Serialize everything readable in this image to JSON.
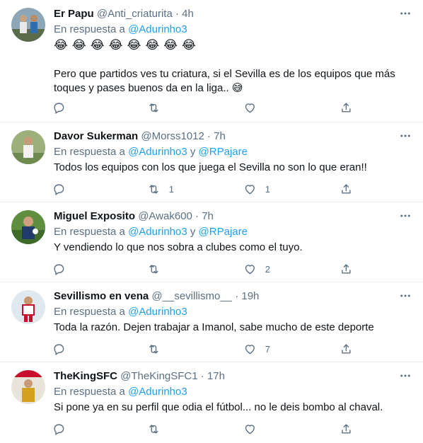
{
  "reply_prefix": "En respuesta a",
  "and_word": "y",
  "tweets": [
    {
      "name": "Er Papu",
      "handle": "@Anti_criaturita",
      "time": "4h",
      "mentions": [
        "@Adurinho3"
      ],
      "emoji_line": "😂😂😂😂😂😂😂😂",
      "text": "Pero que partidos ves tu criatura, si el Sevilla es de los equipos que más toques y pases buenos da en la liga.. 😅",
      "retweets": "",
      "likes": ""
    },
    {
      "name": "Davor Sukerman",
      "handle": "@Morss1012",
      "time": "7h",
      "mentions": [
        "@Adurinho3",
        "@RPajare"
      ],
      "text": "Todos los equipos con los que juega el Sevilla no son lo que eran!!",
      "retweets": "1",
      "likes": "1"
    },
    {
      "name": "Miguel Exposito",
      "handle": "@Awak600",
      "time": "7h",
      "mentions": [
        "@Adurinho3",
        "@RPajare"
      ],
      "text": "Y vendiendo lo que nos sobra a clubes como el tuyo.",
      "retweets": "",
      "likes": "2"
    },
    {
      "name": "Sevillismo en vena",
      "handle": "@__sevillismo__",
      "time": "19h",
      "mentions": [
        "@Adurinho3"
      ],
      "text": "Toda la razón. Dejen trabajar a Imanol, sabe mucho de este deporte",
      "retweets": "",
      "likes": "7"
    },
    {
      "name": "TheKingSFC",
      "handle": "@TheKingSFC1",
      "time": "17h",
      "mentions": [
        "@Adurinho3"
      ],
      "text": "Si pone ya en su perfil que odia el fútbol... no le deis bombo al chaval.",
      "retweets": "",
      "likes": ""
    }
  ],
  "icons": {
    "reply": "reply-icon",
    "retweet": "retweet-icon",
    "like": "like-icon",
    "share": "share-icon",
    "more": "more-icon"
  },
  "colors": {
    "link": "#1da1f2",
    "muted": "#5b7083",
    "text": "#0f1419",
    "divider": "#e6ecf0"
  }
}
